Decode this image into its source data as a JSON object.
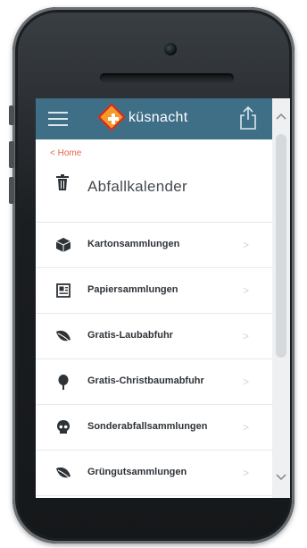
{
  "header": {
    "brand": "küsnacht",
    "colors": {
      "bar": "#3f6f87",
      "accent": "#f39a2a",
      "cross": "#d8241c"
    },
    "icons": {
      "menu": "menu-icon",
      "logo": "kuesnacht-logo-icon",
      "share": "share-icon"
    }
  },
  "nav": {
    "back_label": "< Home"
  },
  "page": {
    "title": "Abfallkalender",
    "title_icon": "trash-icon"
  },
  "categories": [
    {
      "label": "Kartonsammlungen",
      "icon": "box-icon"
    },
    {
      "label": "Papiersammlungen",
      "icon": "newspaper-icon"
    },
    {
      "label": "Gratis-Laubabfuhr",
      "icon": "leaf-icon"
    },
    {
      "label": "Gratis-Christbaumabfuhr",
      "icon": "tree-icon"
    },
    {
      "label": "Sonderabfallsammlungen",
      "icon": "skull-icon"
    },
    {
      "label": "Grüngutsammlungen",
      "icon": "leaf-icon"
    }
  ],
  "chevron": ">"
}
